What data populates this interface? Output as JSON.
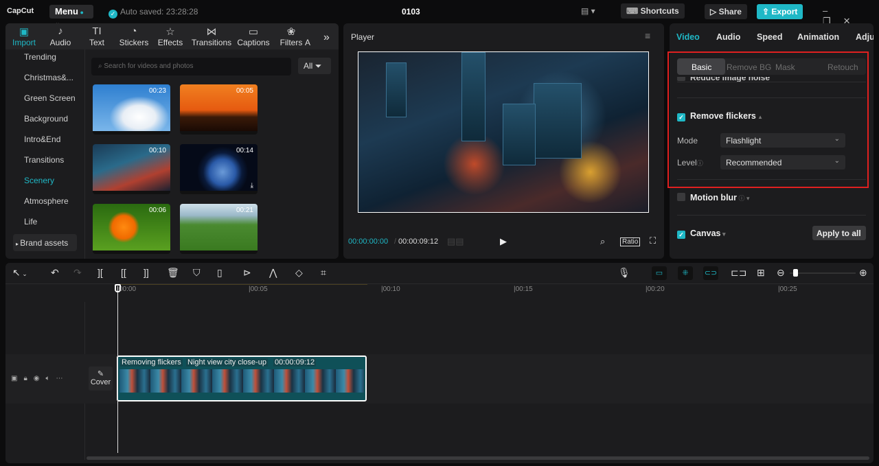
{
  "app": {
    "logo": "CapCut",
    "menu": "Menu",
    "auto_saved": "Auto saved: 23:28:28",
    "project_title": "0103",
    "shortcuts": "Shortcuts",
    "share": "Share",
    "export": "Export"
  },
  "media_tabs": [
    {
      "label": "Import",
      "icon": "import-icon"
    },
    {
      "label": "Audio",
      "icon": "audio-icon"
    },
    {
      "label": "Text",
      "icon": "text-icon"
    },
    {
      "label": "Stickers",
      "icon": "stickers-icon"
    },
    {
      "label": "Effects",
      "icon": "effects-icon"
    },
    {
      "label": "Transitions",
      "icon": "transitions-icon"
    },
    {
      "label": "Captions",
      "icon": "captions-icon"
    },
    {
      "label": "Filters",
      "icon": "filters-icon"
    },
    {
      "label": "A",
      "icon": ""
    }
  ],
  "categories": [
    "Trending",
    "Christmas&...",
    "Green Screen",
    "Background",
    "Intro&End",
    "Transitions",
    "Scenery",
    "Atmosphere",
    "Life"
  ],
  "brand_assets": "Brand assets",
  "search": {
    "placeholder": "Search for videos and photos",
    "filter": "All"
  },
  "media": [
    {
      "duration": "00:23"
    },
    {
      "duration": "00:05"
    },
    {
      "duration": "00:10"
    },
    {
      "duration": "00:14"
    },
    {
      "duration": "00:06"
    },
    {
      "duration": "00:21"
    }
  ],
  "player": {
    "title": "Player",
    "current_time": "00:00:00:00",
    "total_time": "00:00:09:12",
    "ratio": "Ratio"
  },
  "inspector": {
    "tabs": [
      "Video",
      "Audio",
      "Speed",
      "Animation",
      "Adju"
    ],
    "sub_tabs": [
      "Basic",
      "Remove BG",
      "Mask",
      "Retouch"
    ],
    "reduce_noise": "Reduce image noise",
    "remove_flickers": "Remove flickers",
    "mode_label": "Mode",
    "mode_value": "Flashlight",
    "level_label": "Level",
    "level_value": "Recommended",
    "motion_blur": "Motion blur",
    "canvas": "Canvas",
    "apply_all": "Apply to all"
  },
  "timeline": {
    "ticks": [
      "00:00",
      "00:05",
      "00:10",
      "00:15",
      "00:20",
      "00:25"
    ],
    "cover": "Cover",
    "clip": {
      "effect": "Removing flickers",
      "name": "Night view city close-up",
      "duration": "00:00:09:12"
    }
  },
  "colors": {
    "accent": "#1fb8c6",
    "highlight": "#e02020"
  }
}
